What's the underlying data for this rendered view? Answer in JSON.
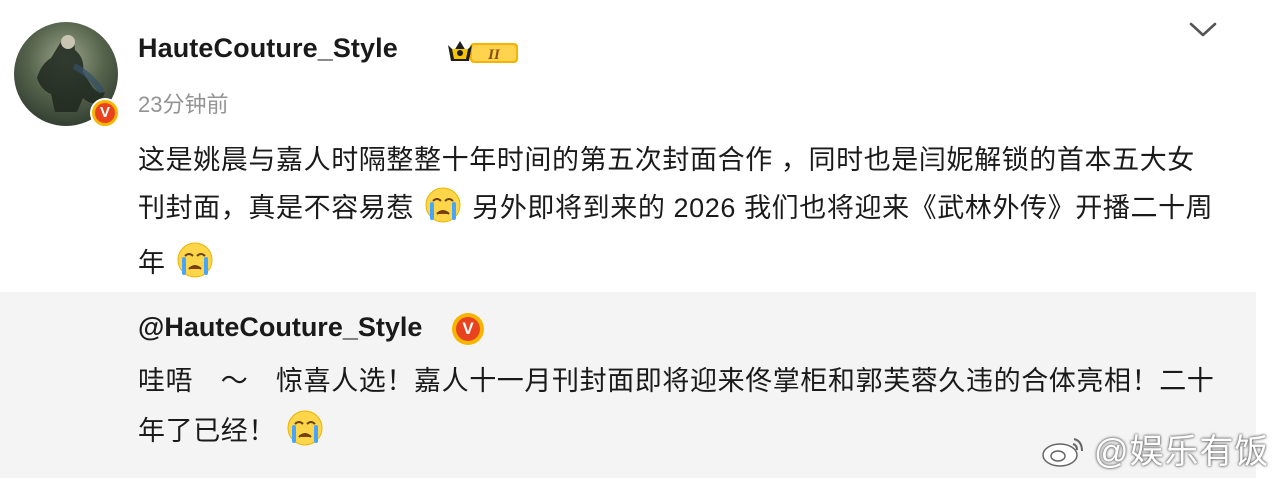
{
  "post": {
    "username": "HauteCouture_Style",
    "level_badge": "II",
    "timestamp": "23分钟前",
    "text_parts": [
      "这是姚晨与嘉人时隔整整十年时间的第五次封面合作 ，同时也是闫妮解锁的首本五大女刊封面，真是不容易惹",
      "另外即将到来的 2026 我们也将迎来《武林外传》开播二十周年"
    ],
    "emoji_name": "crying-face-emoji"
  },
  "repost": {
    "username": "@HauteCouture_Style",
    "text": "哇唔　～　惊喜人选！嘉人十一月刊封面即将迎来佟掌柜和郭芙蓉久违的合体亮相！二十年了已经！"
  },
  "watermark": {
    "text": "@娱乐有饭"
  },
  "colors": {
    "verified_outer": "#f7b500",
    "verified_inner": "#e8421e",
    "timestamp": "#939393",
    "repost_bg": "#f4f4f4"
  }
}
